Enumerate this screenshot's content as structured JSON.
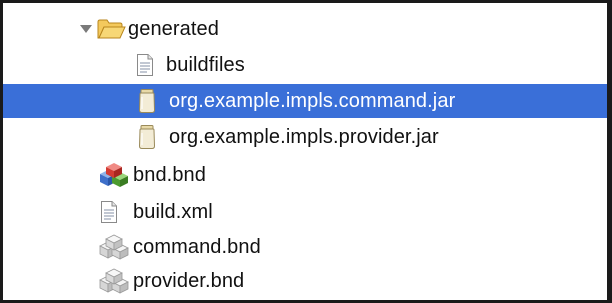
{
  "tree": {
    "items": [
      {
        "label": "generated",
        "icon": "folder-open-icon",
        "expanded": true,
        "level": 1
      },
      {
        "label": "buildfiles",
        "icon": "text-file-icon",
        "level": 2
      },
      {
        "label": "org.example.impls.command.jar",
        "icon": "jar-file-icon",
        "level": 2,
        "selected": true
      },
      {
        "label": "org.example.impls.provider.jar",
        "icon": "jar-file-icon",
        "level": 2
      },
      {
        "label": "bnd.bnd",
        "icon": "bnd-cubes-icon",
        "level": 1
      },
      {
        "label": "build.xml",
        "icon": "text-file-icon",
        "level": 1
      },
      {
        "label": "command.bnd",
        "icon": "gray-cubes-icon",
        "level": 1
      },
      {
        "label": "provider.bnd",
        "icon": "gray-cubes-icon",
        "level": 1
      }
    ]
  },
  "colors": {
    "selection": "#3a6fd8",
    "folder": "#f2c14e"
  }
}
